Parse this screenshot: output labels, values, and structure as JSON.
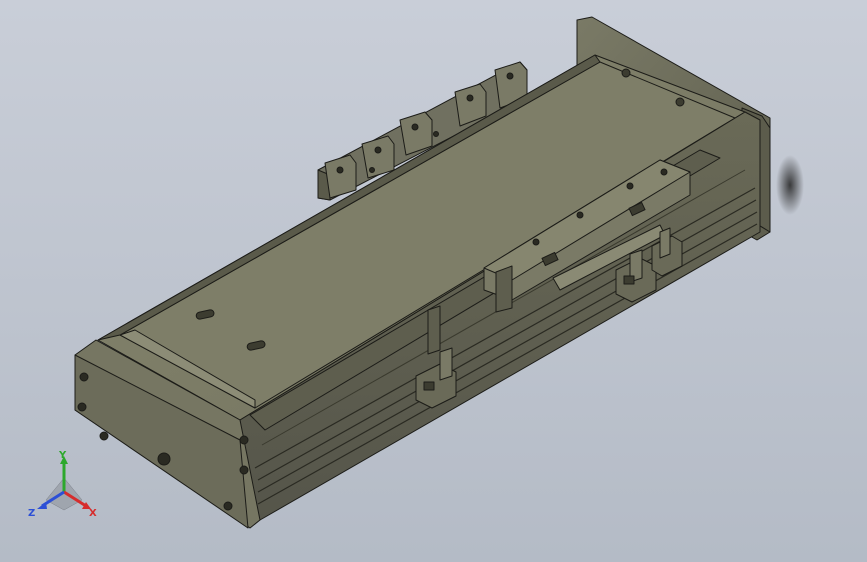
{
  "viewport": {
    "background_top": "#c9ced8",
    "background_bottom": "#b4bbc6"
  },
  "model": {
    "body_color": "#6f6f5c",
    "body_light": "#8a8a74",
    "body_dark": "#4f4f40",
    "edge_color": "#1c1c18"
  },
  "triad": {
    "x_label": "X",
    "y_label": "Y",
    "z_label": "Z",
    "x_color": "#d62c2c",
    "y_color": "#2ca82c",
    "z_color": "#2c4fd6"
  }
}
